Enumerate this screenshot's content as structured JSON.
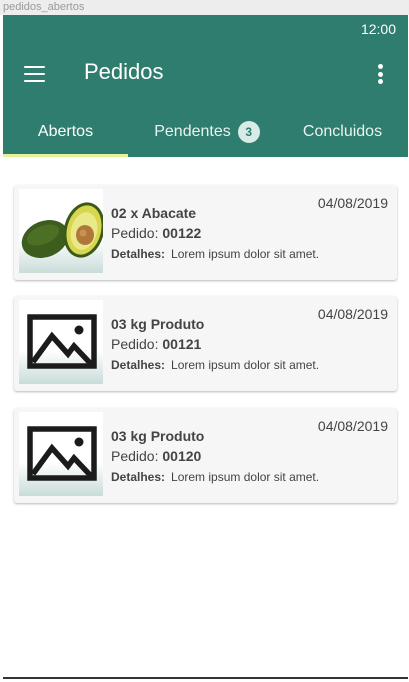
{
  "frame_label": "pedidos_abertos",
  "status_bar": {
    "time": "12:00"
  },
  "app_bar": {
    "title": "Pedidos"
  },
  "tabs": [
    {
      "label": "Abertos",
      "active": true
    },
    {
      "label": "Pendentes",
      "badge": "3",
      "active": false
    },
    {
      "label": "Concluidos",
      "active": false
    }
  ],
  "orders": [
    {
      "name": "02 x Abacate",
      "order_prefix": "Pedido:",
      "order_number": "00122",
      "details_label": "Detalhes:",
      "details": "Lorem ipsum dolor sit amet.",
      "date": "04/08/2019",
      "image": "avocado-photo"
    },
    {
      "name": "03 kg Produto",
      "order_prefix": "Pedido:",
      "order_number": "00121",
      "details_label": "Detalhes:",
      "details": "Lorem ipsum dolor sit amet.",
      "date": "04/08/2019",
      "image": "image-placeholder-icon"
    },
    {
      "name": "03 kg Produto",
      "order_prefix": "Pedido:",
      "order_number": "00120",
      "details_label": "Detalhes:",
      "details": "Lorem ipsum dolor sit amet.",
      "date": "04/08/2019",
      "image": "image-placeholder-icon"
    }
  ],
  "colors": {
    "primary": "#2e7d6e",
    "tab_indicator": "#e6f29a",
    "card_background": "#f6f6f6"
  }
}
